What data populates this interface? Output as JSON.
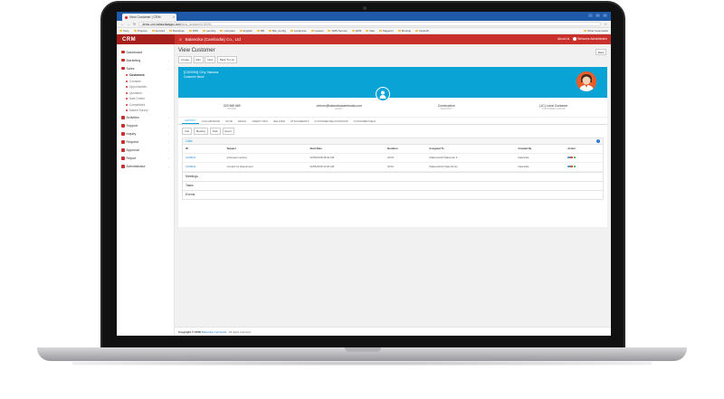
{
  "browser": {
    "tab_title": "View Customer | CRM",
    "url_host": "demo-crm.balancikasppo.com",
    "url_path": "/view_customer/1000/M",
    "bookmarks": [
      "Sony",
      "Prepare",
      "Android",
      "Bootstrap",
      "FMS",
      "security",
      "computer",
      "English",
      "DB",
      "Bat_Config",
      "wordpress",
      "Laravel",
      "SMS Service",
      "EPM",
      "Mac",
      "Magento",
      "Mockup",
      "NodeJS"
    ],
    "other_bookmarks": "Other bookmarks"
  },
  "header": {
    "logo": "CRM",
    "company": "Balancika (Cambodia) Co., Ltd",
    "about": "About Us",
    "welcome": "Welcome Administrator"
  },
  "sidebar": {
    "items": [
      {
        "label": "Dashboard",
        "color": "#c9302c"
      },
      {
        "label": "Marketing",
        "color": "#c9302c"
      },
      {
        "label": "Sales",
        "color": "#c9302c"
      }
    ],
    "sub_items": [
      {
        "label": "Customers",
        "active": true
      },
      {
        "label": "Contacts",
        "active": false
      },
      {
        "label": "Opportunities",
        "active": false
      },
      {
        "label": "Quotation",
        "active": false
      },
      {
        "label": "Sale Orders",
        "active": false
      },
      {
        "label": "Competitors",
        "active": false
      },
      {
        "label": "Market Survey",
        "active": false
      }
    ],
    "items_after": [
      {
        "label": "Activities"
      },
      {
        "label": "Support"
      },
      {
        "label": "Inquiry"
      },
      {
        "label": "Request"
      },
      {
        "label": "Approval"
      },
      {
        "label": "Report"
      },
      {
        "label": "Administrator"
      }
    ]
  },
  "page": {
    "title": "View Customer",
    "back": "Back",
    "toolbar": [
      "Create",
      "Edit",
      "Help",
      "Back To List"
    ]
  },
  "profile": {
    "name": "[C00094] Chy Vanara",
    "subtitle": "Customer Items",
    "stats": [
      {
        "value": "023 966 669",
        "label": "PHONE"
      },
      {
        "value": "chhorn@balancikacambodia.com",
        "label": "EMAIL"
      },
      {
        "value": "Construction",
        "label": "INDUSTRY"
      },
      {
        "value": "(1C) Local Customer",
        "label": "CUSTOMER GROUP"
      }
    ]
  },
  "tabs": [
    "ACTIVITY",
    "COLLABORATE",
    "NOTE",
    "DETAIL",
    "CREDIT INFO",
    "RELATED",
    "ATTACHMENTS",
    "CUSTOMER RELATIONSHIP",
    "CUSTOMER FIELD"
  ],
  "subbar": [
    "Call",
    "Meeting",
    "Task",
    "Event"
  ],
  "calls": {
    "title": "Calls",
    "columns": [
      "ID",
      "Subject",
      "Start Date",
      "Duration",
      "Assigned To",
      "Created By",
      "Action"
    ],
    "rows": [
      {
        "id": "CL00011",
        "subject": "arranged meeting",
        "start": "22/06/2018 08:00 AM",
        "duration": "00:22",
        "assigned": "[Salesman2] Salesman 2",
        "created": "balancika"
      },
      {
        "id": "CL00012",
        "subject": "Contact for Requirment",
        "start": "20/06/2018 10:00 AM",
        "duration": "00:10",
        "assigned": "[SalesAdmin] Sale Admin",
        "created": "balancika"
      }
    ]
  },
  "sections": [
    "Meetings",
    "Tasks",
    "Events"
  ],
  "footer": {
    "prefix": "Copyright © 2018",
    "brand": "Balancika Cambodia",
    "suffix": ". All rights reserved."
  },
  "colors": {
    "header_red": "#c9302c",
    "banner_blue": "#0aa3d6",
    "link_blue": "#1a7ec9"
  }
}
